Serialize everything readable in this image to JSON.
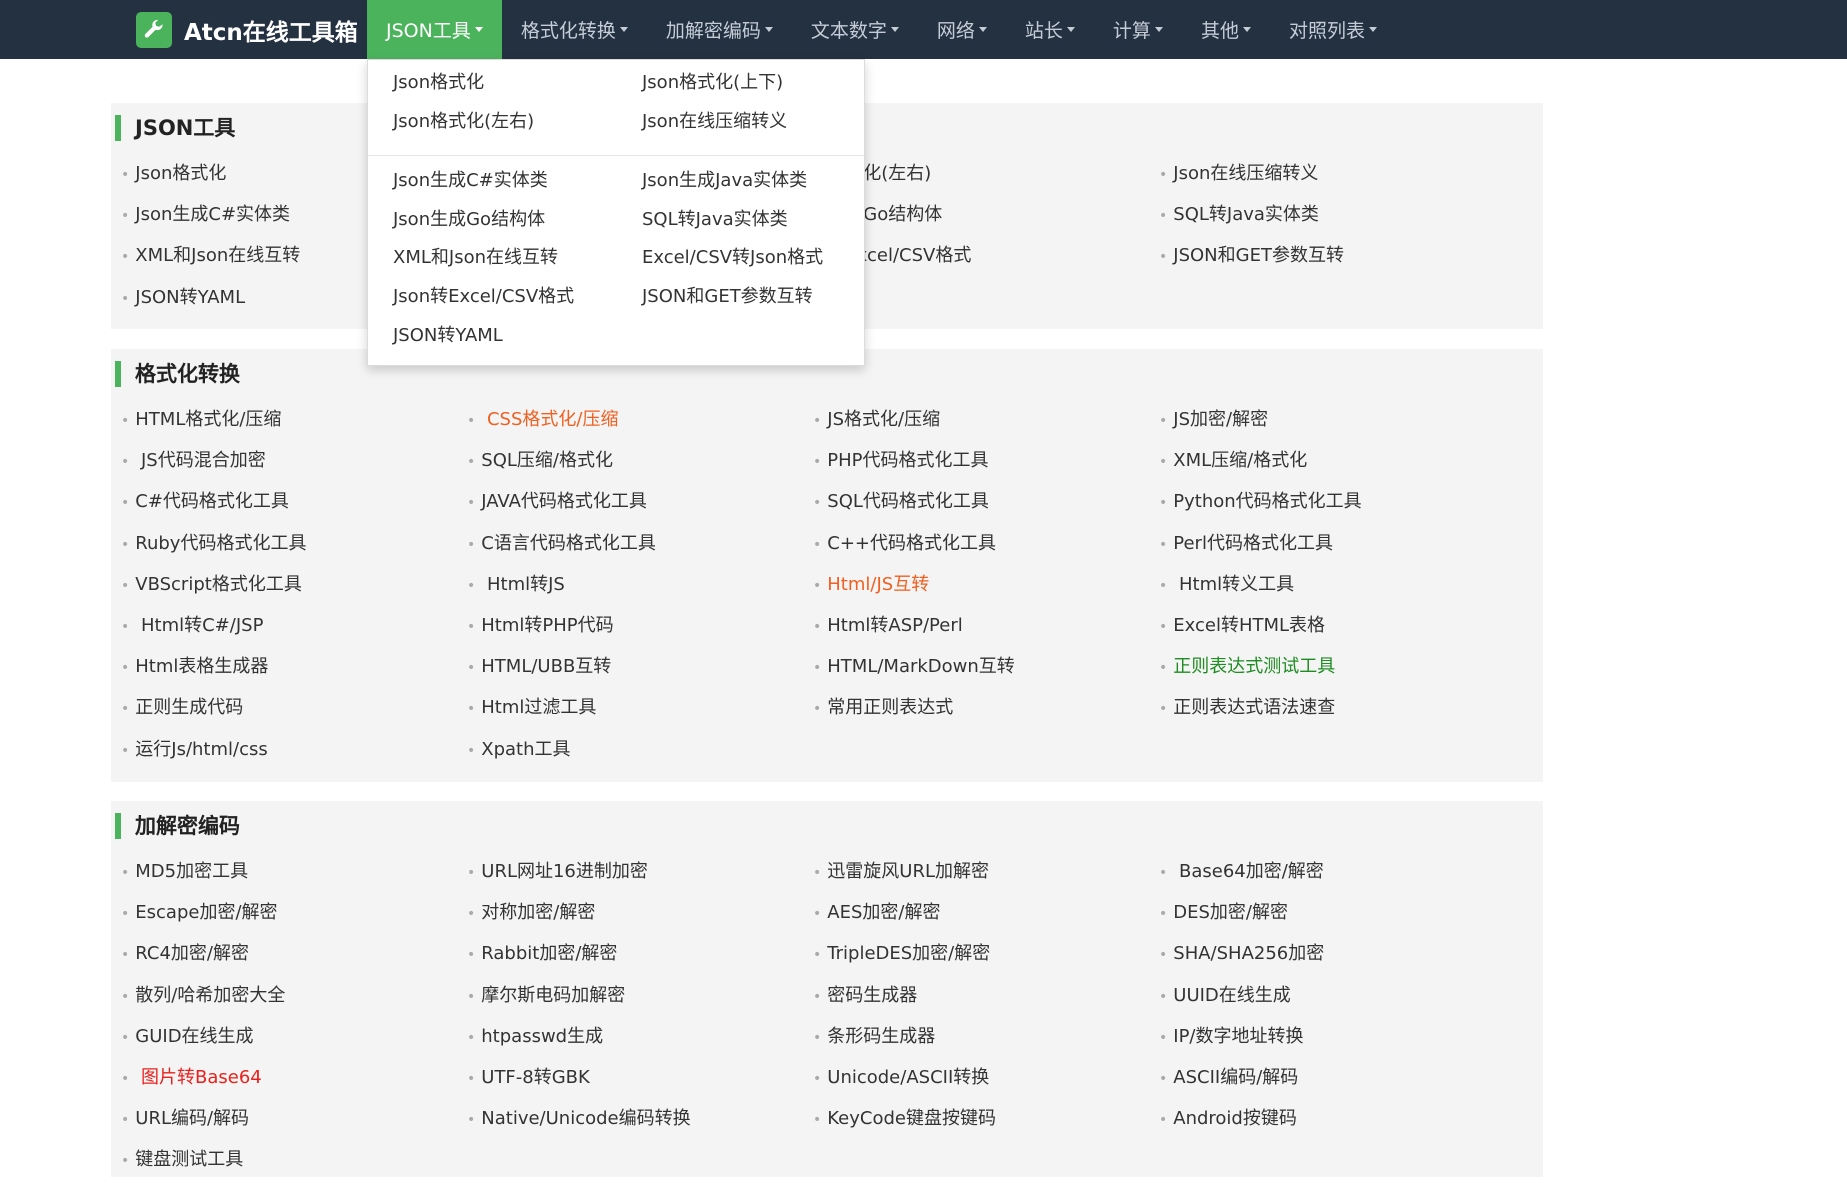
{
  "brand": {
    "name": "Atcn在线工具箱",
    "icon": "wrench-icon",
    "accent": "#4cb35d"
  },
  "nav": [
    {
      "id": "json",
      "label": "JSON工具",
      "active": true
    },
    {
      "id": "format",
      "label": "格式化转换"
    },
    {
      "id": "encrypt",
      "label": "加解密编码"
    },
    {
      "id": "text",
      "label": "文本数字"
    },
    {
      "id": "network",
      "label": "网络"
    },
    {
      "id": "webmaster",
      "label": "站长"
    },
    {
      "id": "calc",
      "label": "计算"
    },
    {
      "id": "other",
      "label": "其他"
    },
    {
      "id": "compare",
      "label": "对照列表"
    }
  ],
  "dropdown": {
    "group1": [
      "Json格式化",
      "Json格式化(上下)",
      "Json格式化(左右)",
      "Json在线压缩转义"
    ],
    "group2": [
      "Json生成C#实体类",
      "Json生成Java实体类",
      "Json生成Go结构体",
      "SQL转Java实体类",
      "XML和Json在线互转",
      "Excel/CSV转Json格式",
      "Json转Excel/CSV格式",
      "JSON和GET参数互转",
      "JSON转YAML"
    ]
  },
  "sections": [
    {
      "title": "JSON工具",
      "tools": [
        {
          "label": "Json格式化"
        },
        {
          "label": ""
        },
        {
          "label": "格式化(左右)"
        },
        {
          "label": "Json在线压缩转义"
        },
        {
          "label": "Json生成C#实体类"
        },
        {
          "label": ""
        },
        {
          "label": "生成Go结构体"
        },
        {
          "label": "SQL转Java实体类"
        },
        {
          "label": "XML和Json在线互转"
        },
        {
          "label": ""
        },
        {
          "label": "转Excel/CSV格式"
        },
        {
          "label": "JSON和GET参数互转"
        },
        {
          "label": "JSON转YAML"
        }
      ]
    },
    {
      "title": "格式化转换",
      "tools": [
        {
          "label": "HTML格式化/压缩"
        },
        {
          "label": " CSS格式化/压缩",
          "color": "orange"
        },
        {
          "label": "JS格式化/压缩"
        },
        {
          "label": "JS加密/解密"
        },
        {
          "label": " JS代码混合加密"
        },
        {
          "label": "SQL压缩/格式化"
        },
        {
          "label": "PHP代码格式化工具"
        },
        {
          "label": "XML压缩/格式化"
        },
        {
          "label": "C#代码格式化工具"
        },
        {
          "label": "JAVA代码格式化工具"
        },
        {
          "label": "SQL代码格式化工具"
        },
        {
          "label": "Python代码格式化工具"
        },
        {
          "label": "Ruby代码格式化工具"
        },
        {
          "label": "C语言代码格式化工具"
        },
        {
          "label": "C++代码格式化工具"
        },
        {
          "label": "Perl代码格式化工具"
        },
        {
          "label": "VBScript格式化工具"
        },
        {
          "label": " Html转JS"
        },
        {
          "label": "Html/JS互转",
          "color": "orange"
        },
        {
          "label": " Html转义工具"
        },
        {
          "label": " Html转C#/JSP"
        },
        {
          "label": "Html转PHP代码"
        },
        {
          "label": "Html转ASP/Perl"
        },
        {
          "label": "Excel转HTML表格"
        },
        {
          "label": "Html表格生成器"
        },
        {
          "label": "HTML/UBB互转"
        },
        {
          "label": "HTML/MarkDown互转"
        },
        {
          "label": "正则表达式测试工具",
          "color": "green"
        },
        {
          "label": "正则生成代码"
        },
        {
          "label": "Html过滤工具"
        },
        {
          "label": "常用正则表达式"
        },
        {
          "label": "正则表达式语法速查"
        },
        {
          "label": "运行Js/html/css"
        },
        {
          "label": "Xpath工具"
        }
      ]
    },
    {
      "title": "加解密编码",
      "tools": [
        {
          "label": "MD5加密工具"
        },
        {
          "label": "URL网址16进制加密"
        },
        {
          "label": "迅雷旋风URL加解密"
        },
        {
          "label": " Base64加密/解密"
        },
        {
          "label": "Escape加密/解密"
        },
        {
          "label": "对称加密/解密"
        },
        {
          "label": "AES加密/解密"
        },
        {
          "label": "DES加密/解密"
        },
        {
          "label": "RC4加密/解密"
        },
        {
          "label": "Rabbit加密/解密"
        },
        {
          "label": "TripleDES加密/解密"
        },
        {
          "label": "SHA/SHA256加密"
        },
        {
          "label": "散列/哈希加密大全"
        },
        {
          "label": "摩尔斯电码加解密"
        },
        {
          "label": "密码生成器"
        },
        {
          "label": "UUID在线生成"
        },
        {
          "label": "GUID在线生成"
        },
        {
          "label": "htpasswd生成"
        },
        {
          "label": "条形码生成器"
        },
        {
          "label": "IP/数字地址转换"
        },
        {
          "label": " 图片转Base64",
          "color": "red"
        },
        {
          "label": "UTF-8转GBK"
        },
        {
          "label": "Unicode/ASCII转换"
        },
        {
          "label": "ASCII编码/解码"
        },
        {
          "label": "URL编码/解码"
        },
        {
          "label": "Native/Unicode编码转换"
        },
        {
          "label": "KeyCode键盘按键码"
        },
        {
          "label": "Android按键码"
        },
        {
          "label": "键盘测试工具"
        }
      ]
    }
  ]
}
